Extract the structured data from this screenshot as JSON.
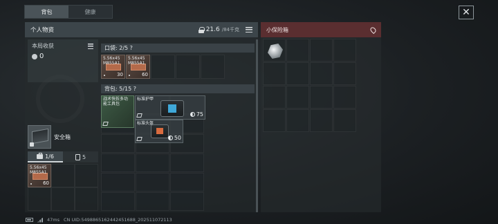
{
  "tabs": [
    {
      "label": "背包",
      "active": true
    },
    {
      "label": "健康",
      "active": false
    }
  ],
  "personal": {
    "title": "个人物资",
    "weight": "21.6",
    "weight_max": "/84千克"
  },
  "round_loot": {
    "label": "本局收获",
    "value": "0"
  },
  "safebox": {
    "label": "安全箱"
  },
  "sub_tabs": [
    {
      "value": "1/6",
      "icon": "kit-icon",
      "active": true
    },
    {
      "value": "5",
      "icon": "bag-icon",
      "active": false
    }
  ],
  "safe_item": {
    "name": "5.56x45\nM855A1",
    "count": "60"
  },
  "pocket": {
    "header": "口袋: 2/5 ?",
    "items": [
      {
        "name": "5.56x45\nM855A1",
        "count": "30"
      },
      {
        "name": "5.56x45\nM855A1",
        "count": "60"
      }
    ]
  },
  "backpack": {
    "header": "背包: 5/15 ?",
    "items": [
      {
        "name": "战术快拆多功\n能工具包",
        "type": "green"
      },
      {
        "name": "标准护甲",
        "durability": "75"
      },
      {
        "name": "标准头盔",
        "durability": "50"
      }
    ]
  },
  "insurance": {
    "title": "小保险箱"
  },
  "footer": {
    "ping": "47ms",
    "uid": "CN UID:5498865162442451688_202511072113"
  },
  "colors": {
    "insurance_header": "#5a2e30",
    "panel_header": "#3c454a"
  }
}
